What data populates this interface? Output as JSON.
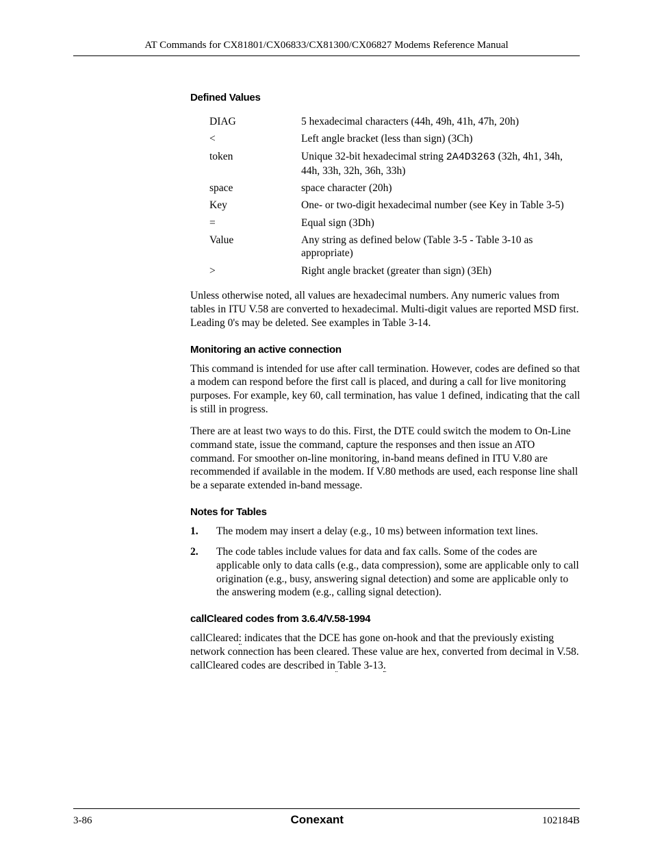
{
  "header": {
    "title": "AT Commands for CX81801/CX06833/CX81300/CX06827 Modems Reference Manual"
  },
  "sections": {
    "defined_values_heading": "Defined Values",
    "defined_values": [
      {
        "term": "DIAG",
        "def": "5 hexadecimal characters (44h, 49h, 41h, 47h, 20h)"
      },
      {
        "term": "<",
        "def": "Left angle bracket (less than sign) (3Ch)"
      },
      {
        "term": "token",
        "def_prefix": "Unique 32-bit hexadecimal string ",
        "def_mono": "2A4D3263",
        "def_suffix": " (32h, 4h1, 34h, 44h, 33h, 32h, 36h, 33h)"
      },
      {
        "term": "space",
        "def": "space character (20h)"
      },
      {
        "term": "Key",
        "def": "One- or two-digit hexadecimal number (see Key in Table 3-5)"
      },
      {
        "term": "=",
        "def": "Equal sign (3Dh)"
      },
      {
        "term": "Value",
        "def": "Any string as defined below (Table 3-5 - Table 3-10 as appropriate)"
      },
      {
        "term": ">",
        "def": "Right angle bracket (greater than sign) (3Eh)"
      }
    ],
    "defined_values_note": "Unless otherwise noted, all values are hexadecimal numbers. Any numeric values from tables in ITU V.58 are converted to hexadecimal. Multi-digit values are reported MSD first. Leading 0's may be deleted. See examples in Table 3-14.",
    "monitoring_heading": "Monitoring an active connection",
    "monitoring_p1": "This command is intended for use after call termination. However, codes are defined so that a modem can respond before the first call is placed, and during a call for live monitoring purposes. For example, key 60, call termination, has value 1 defined, indicating that the call is still in progress.",
    "monitoring_p2": "There are at least two ways to do this. First, the DTE could switch the modem to On-Line command state, issue the command, capture the responses and then issue an ATO command. For smoother on-line monitoring, in-band means defined in ITU V.80 are recommended if available in the modem. If V.80 methods are used, each response line shall be a separate extended in-band message.",
    "notes_heading": "Notes for Tables",
    "notes": [
      "The modem may insert a delay (e.g., 10 ms) between information text lines.",
      "The code tables include values for data and fax calls. Some of the codes are applicable only to data calls (e.g., data compression), some are applicable only to call origination (e.g., busy, answering signal detection) and some are applicable only to the answering modem (e.g., calling signal detection)."
    ],
    "callcleared_heading": "callCleared codes from 3.6.4/V.58-1994",
    "callcleared_parts": {
      "t1": "callCleared",
      "colon": ":",
      "t2": " indicates that the DCE has gone on-hook and that the previously existing network connection has been cleared. These value are hex, converted from decimal in V.58. callCleared codes are described in",
      "link_space": " ",
      "link": "Table 3-13",
      "period": "."
    }
  },
  "footer": {
    "left": "3-86",
    "center": "Conexant",
    "right": "102184B"
  }
}
